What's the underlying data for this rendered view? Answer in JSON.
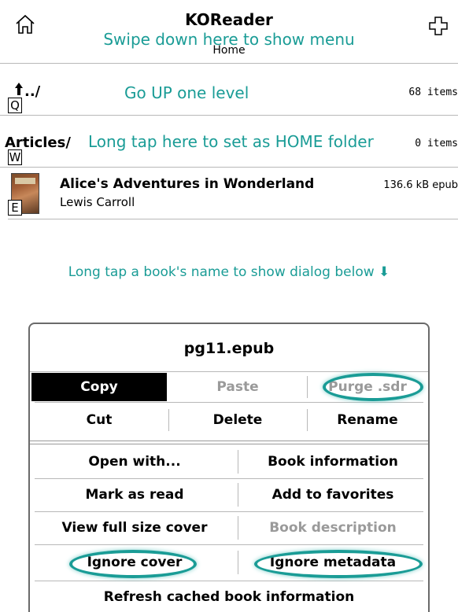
{
  "header": {
    "title": "KOReader",
    "subtitle": "Home",
    "hint": "Swipe down here to show menu",
    "home_icon": "home-icon",
    "plus_icon": "plus-icon"
  },
  "file_list": [
    {
      "name": "../",
      "meta": "68 items",
      "hint": "Go UP one level",
      "key": "Q",
      "icon": "up-arrow-icon"
    },
    {
      "name": "Articles/",
      "meta": "0 items",
      "hint": "Long tap here to set as HOME folder",
      "key": "W"
    },
    {
      "name": "Alice's Adventures in Wonderland",
      "author": "Lewis Carroll",
      "meta": "136.6 kB  epub",
      "key": "E"
    }
  ],
  "instruction": "Long tap a book's name to show dialog below ⬇",
  "dialog": {
    "title": "pg11.epub",
    "row1": [
      "Copy",
      "Paste",
      "Purge .sdr"
    ],
    "row2": [
      "Cut",
      "Delete",
      "Rename"
    ],
    "grid": [
      [
        "Open with...",
        "Book information"
      ],
      [
        "Mark as read",
        "Add to favorites"
      ],
      [
        "View full size cover",
        "Book description"
      ],
      [
        "Ignore cover",
        "Ignore metadata"
      ]
    ],
    "bottom": "Refresh cached book information"
  },
  "colors": {
    "accent": "#1a9c96",
    "disabled": "#9a9a9a",
    "selected_bg": "#000000"
  }
}
